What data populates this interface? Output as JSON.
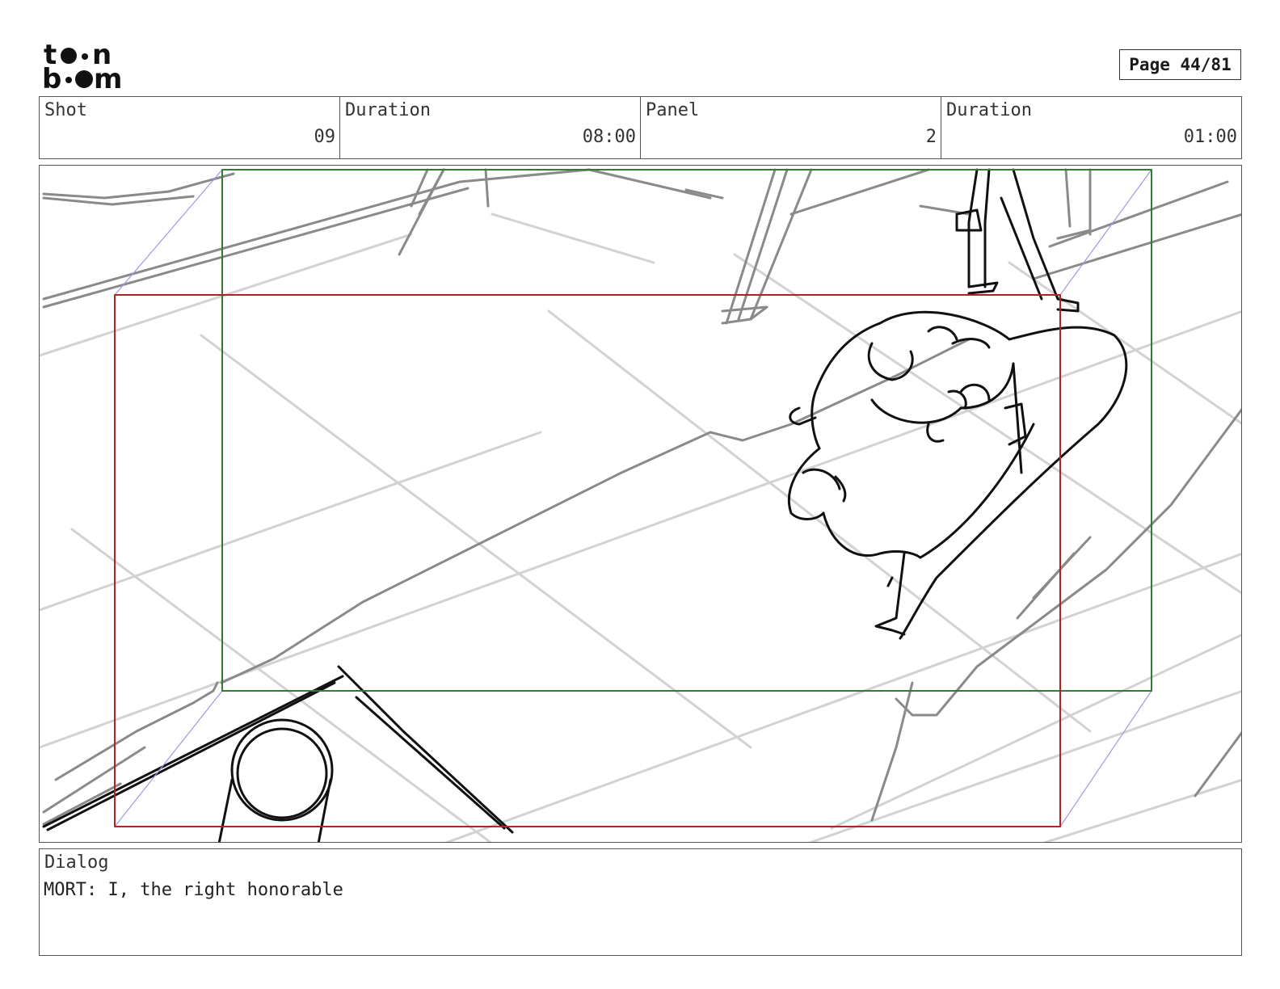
{
  "brand": {
    "logo_line1": "t••n",
    "logo_line2": "b••m"
  },
  "page": {
    "label": "Page 44/81"
  },
  "header": {
    "cells": [
      {
        "label": "Shot",
        "value": "09"
      },
      {
        "label": "Duration",
        "value": "08:00"
      },
      {
        "label": "Panel",
        "value": "2"
      },
      {
        "label": "Duration",
        "value": "01:00"
      }
    ]
  },
  "dialog": {
    "label": "Dialog",
    "text": "MORT: I, the right honorable"
  },
  "colors": {
    "safe_frame_green": "#2e7d32",
    "camera_frame_red": "#b22222",
    "guide_blue": "#9a9ae8",
    "sketch_dark": "#111111",
    "sketch_gray": "#8a8a8a",
    "sketch_light": "#d2d2d2"
  }
}
